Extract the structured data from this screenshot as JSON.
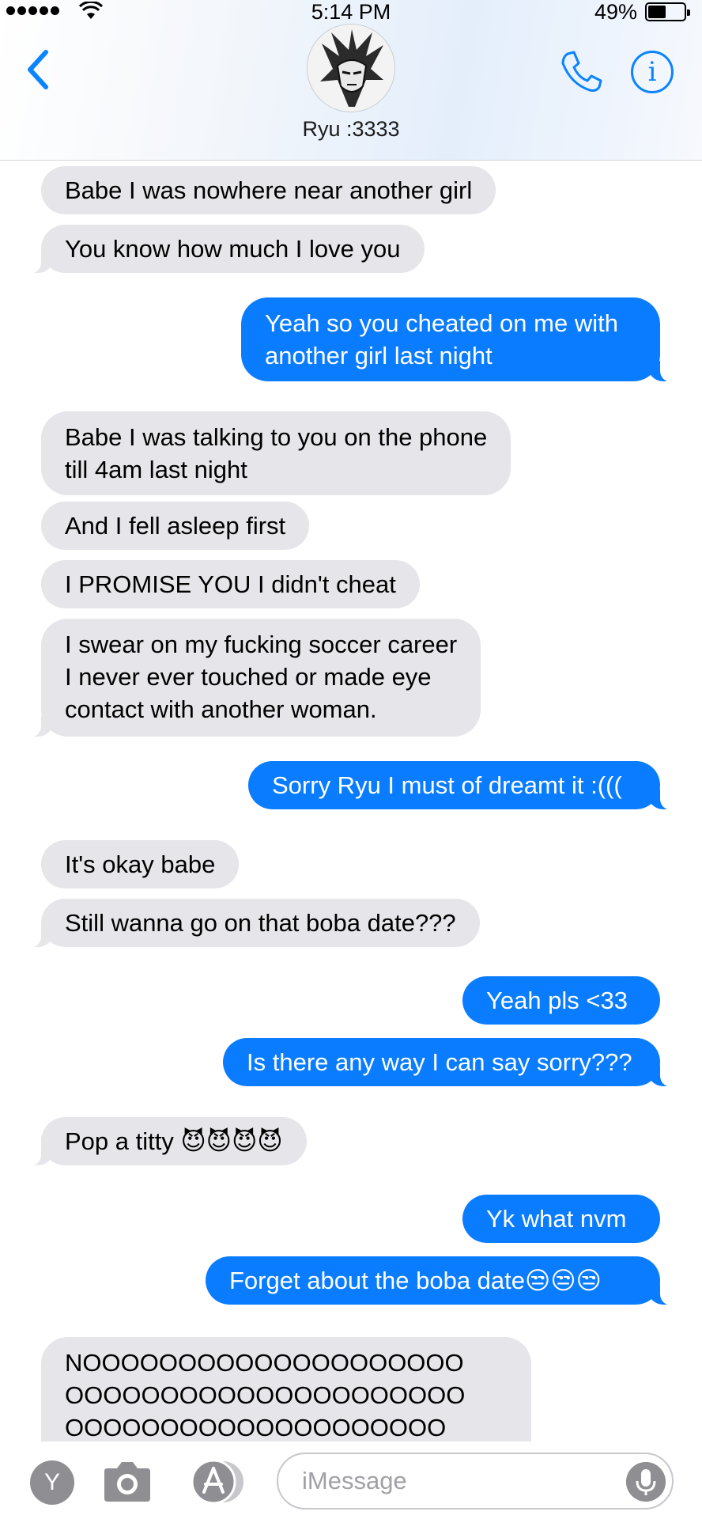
{
  "status_bar": {
    "time": "5:14 PM",
    "battery": "49%",
    "battery_level": 0.49
  },
  "header": {
    "contact_name": "Ryu :3333"
  },
  "messages": [
    {
      "dir": "in",
      "text": "Babe I was nowhere near another girl"
    },
    {
      "dir": "in",
      "text": "You know how much I love you"
    },
    {
      "dir": "out",
      "text": "Yeah so you cheated on me with\nanother girl last night"
    },
    {
      "dir": "in",
      "text": "Babe I was talking to you on the phone\ntill 4am last night"
    },
    {
      "dir": "in",
      "text": "And I fell asleep first"
    },
    {
      "dir": "in",
      "text": "I PROMISE YOU I didn't cheat"
    },
    {
      "dir": "in",
      "text": "I swear on my fucking soccer career\nI never ever touched or made eye\ncontact with another woman."
    },
    {
      "dir": "out",
      "text": "Sorry Ryu I must of dreamt it :((("
    },
    {
      "dir": "in",
      "text": "It's okay babe"
    },
    {
      "dir": "in",
      "text": "Still wanna go on that boba date???"
    },
    {
      "dir": "out",
      "text": "Yeah pls <33"
    },
    {
      "dir": "out",
      "text": "Is there any way I can say sorry???"
    },
    {
      "dir": "in",
      "text": "Pop a titty 😈😈😈😈"
    },
    {
      "dir": "out",
      "text": "Yk what nvm"
    },
    {
      "dir": "out",
      "text": "Forget about the boba date😒😒😒"
    },
    {
      "dir": "in",
      "text": "NOOOOOOOOOOOOOOOOOOOO\nOOOOOOOOOOOOOOOOOOOOO\nOOOOOOOOOOOOOOOOOOOO"
    }
  ],
  "input": {
    "placeholder": "iMessage",
    "app_label": "Y"
  },
  "colors": {
    "accent": "#0a7cff",
    "incoming_bubble": "#e5e5ea"
  },
  "icons": {
    "back": "chevron-left-icon",
    "phone": "phone-icon",
    "info": "info-icon",
    "camera": "camera-icon",
    "apps": "app-store-icon",
    "mic": "microphone-icon"
  }
}
